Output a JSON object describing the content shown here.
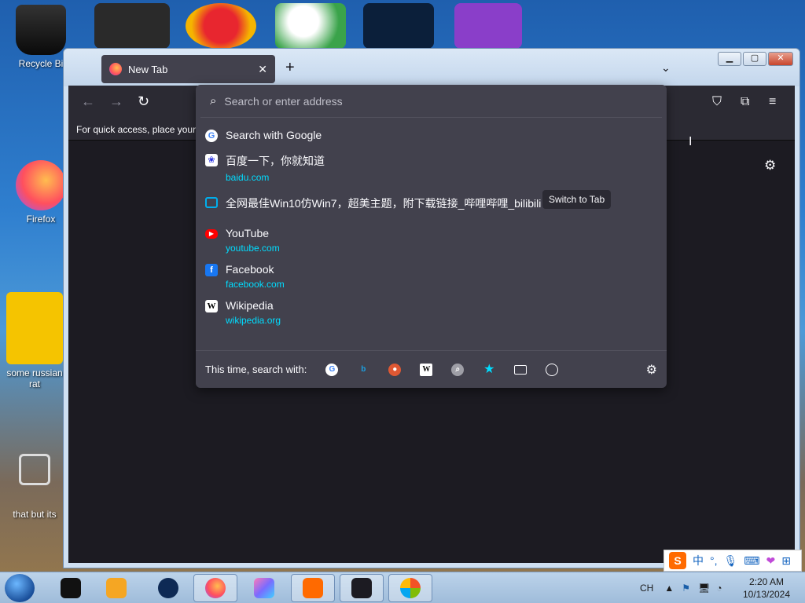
{
  "desktop": {
    "icons": [
      {
        "label": "Recycle Bi"
      },
      {
        "label": "Firefox"
      },
      {
        "label": "some russian rat"
      },
      {
        "label": "that but its"
      }
    ]
  },
  "browser": {
    "tab_title": "New Tab",
    "bookmarks_hint": "For quick access, place your b",
    "url_placeholder": "Search or enter address"
  },
  "suggestions": [
    {
      "icon": "google-icon",
      "title": "Search with Google",
      "url": ""
    },
    {
      "icon": "baidu-icon",
      "title": "百度一下，你就知道",
      "url": "baidu.com"
    },
    {
      "icon": "bilibili-icon",
      "title": "全网最佳Win10仿Win7，超美主题，附下载链接_哔哩哔哩_bilibili",
      "url": "",
      "action": "Switch to Tab"
    },
    {
      "icon": "youtube-icon",
      "title": "YouTube",
      "url": "youtube.com"
    },
    {
      "icon": "facebook-icon",
      "title": "Facebook",
      "url": "facebook.com"
    },
    {
      "icon": "wikipedia-icon",
      "title": "Wikipedia",
      "url": "wikipedia.org"
    }
  ],
  "one_off": {
    "label": "This time, search with:",
    "engines": [
      "google-icon",
      "bing-icon",
      "duckduckgo-icon",
      "wikipedia-icon",
      "search-engine-icon",
      "bookmarks-star-icon",
      "tabs-icon",
      "history-clock-icon"
    ]
  },
  "ime": {
    "lang": "中"
  },
  "taskbar": {
    "lang": "CH",
    "time": "2:20 AM",
    "date": "10/13/2024"
  },
  "colors": {
    "accent_link": "#00ddff",
    "panel_bg": "#42414d",
    "toolbar_bg": "#2b2a33"
  }
}
